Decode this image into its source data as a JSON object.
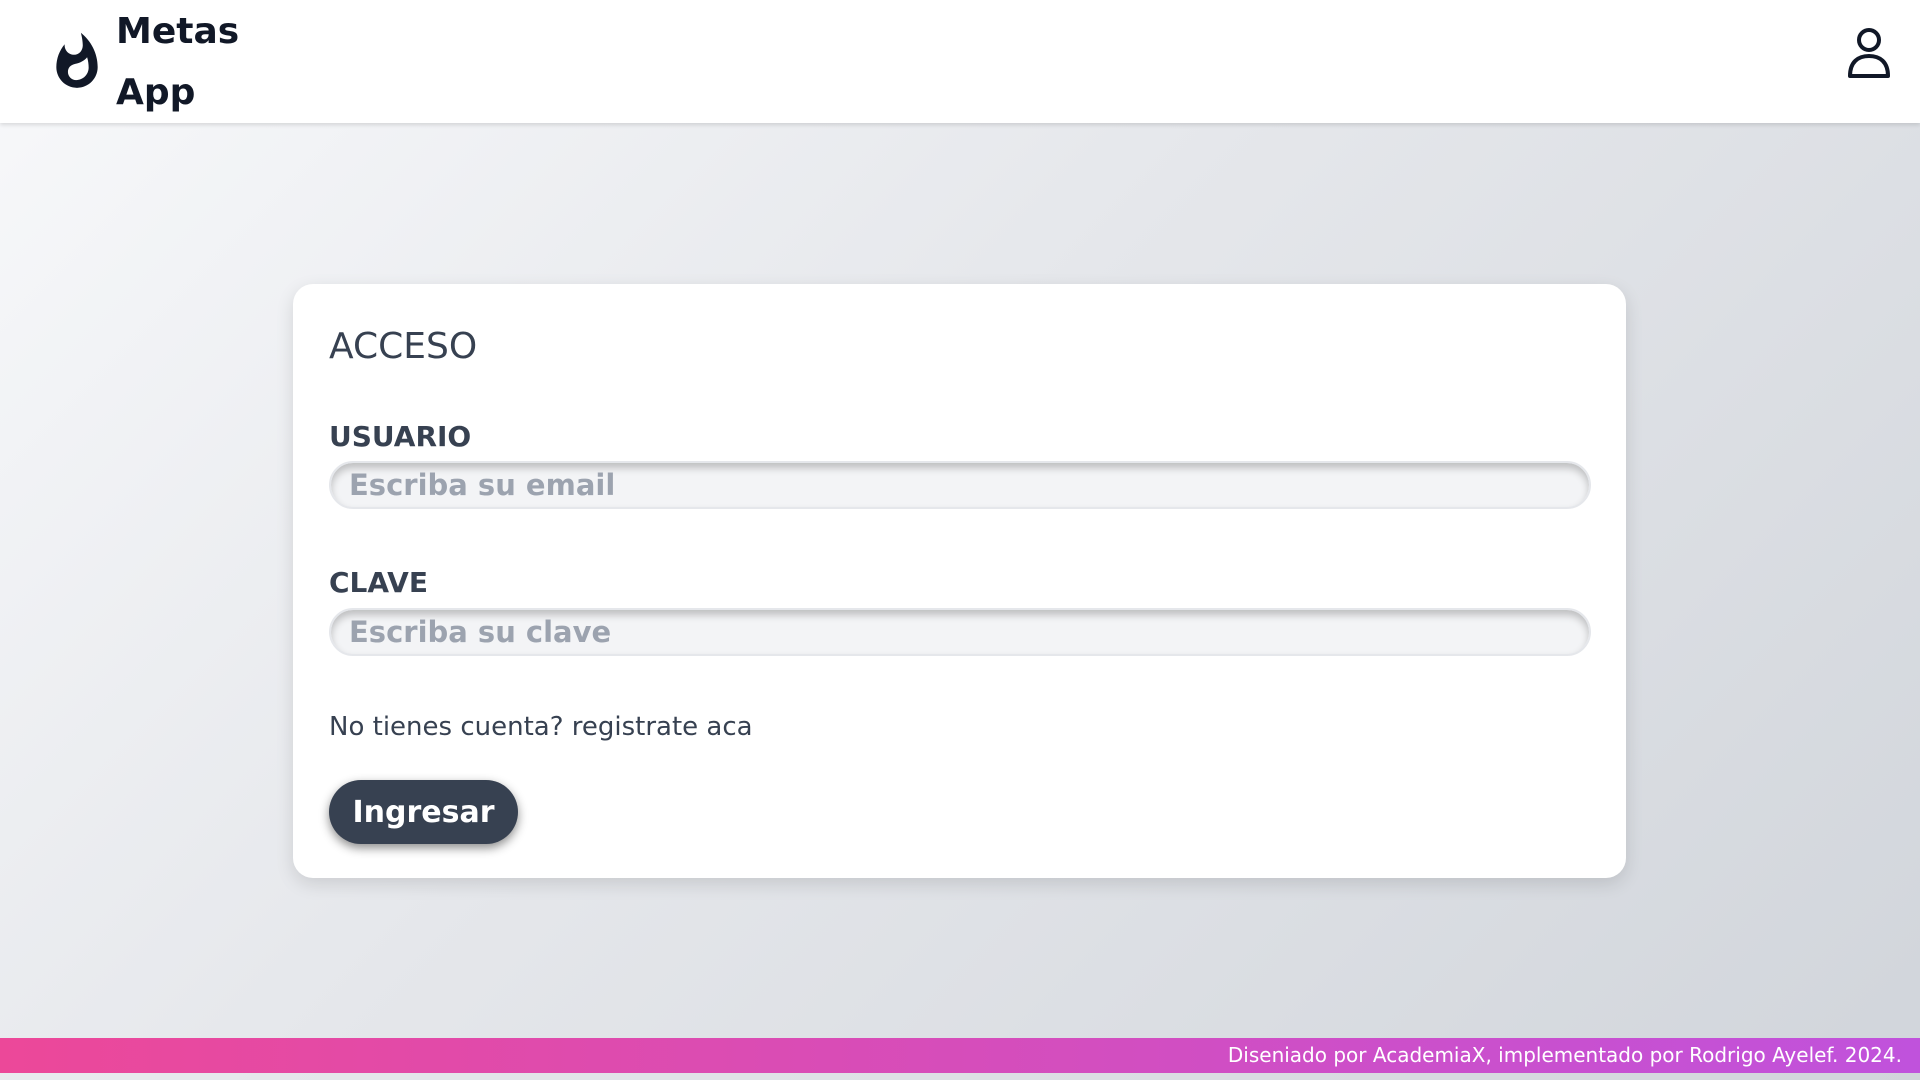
{
  "header": {
    "logo_icon": "fire-icon",
    "app_name": "Metas App",
    "user_icon": "user-icon"
  },
  "login": {
    "title": "ACCESO",
    "user_label": "USUARIO",
    "user_placeholder": "Escriba su email",
    "user_value": "",
    "password_label": "CLAVE",
    "password_placeholder": "Escriba su clave",
    "password_value": "",
    "register_text": "No tienes cuenta? registrate aca",
    "submit_label": "Ingresar"
  },
  "footer": {
    "credits": "Diseniado por AcademiaX, implementado por Rodrigo Ayelef. 2024."
  },
  "colors": {
    "primary_dark": "#374151",
    "footer_gradient_start": "#ec4899",
    "footer_gradient_end": "#c052dc"
  }
}
